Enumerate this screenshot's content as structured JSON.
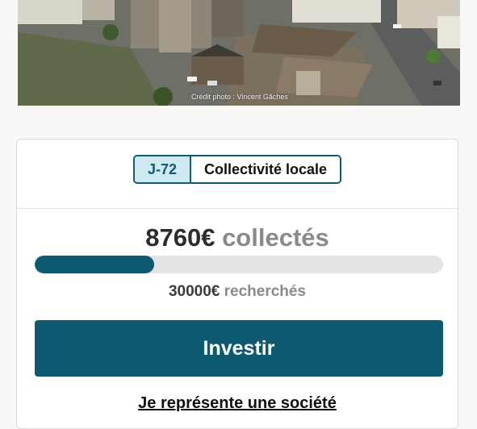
{
  "hero": {
    "alt": "Aerial view of town square with church",
    "credit": "Crédit photo : Vincent Gâches"
  },
  "card": {
    "badge_days": "J-72",
    "badge_type": "Collectivité locale",
    "collected_amount": "8760€",
    "collected_label": "collectés",
    "progress_fraction": 0.292,
    "sought_amount": "30000€",
    "sought_label": "recherchés",
    "invest_label": "Investir",
    "company_link": "Je représente une société"
  },
  "colors": {
    "primary": "#0d5a70",
    "badge_bg": "#cfe9f3",
    "track": "#e3e4e6"
  }
}
